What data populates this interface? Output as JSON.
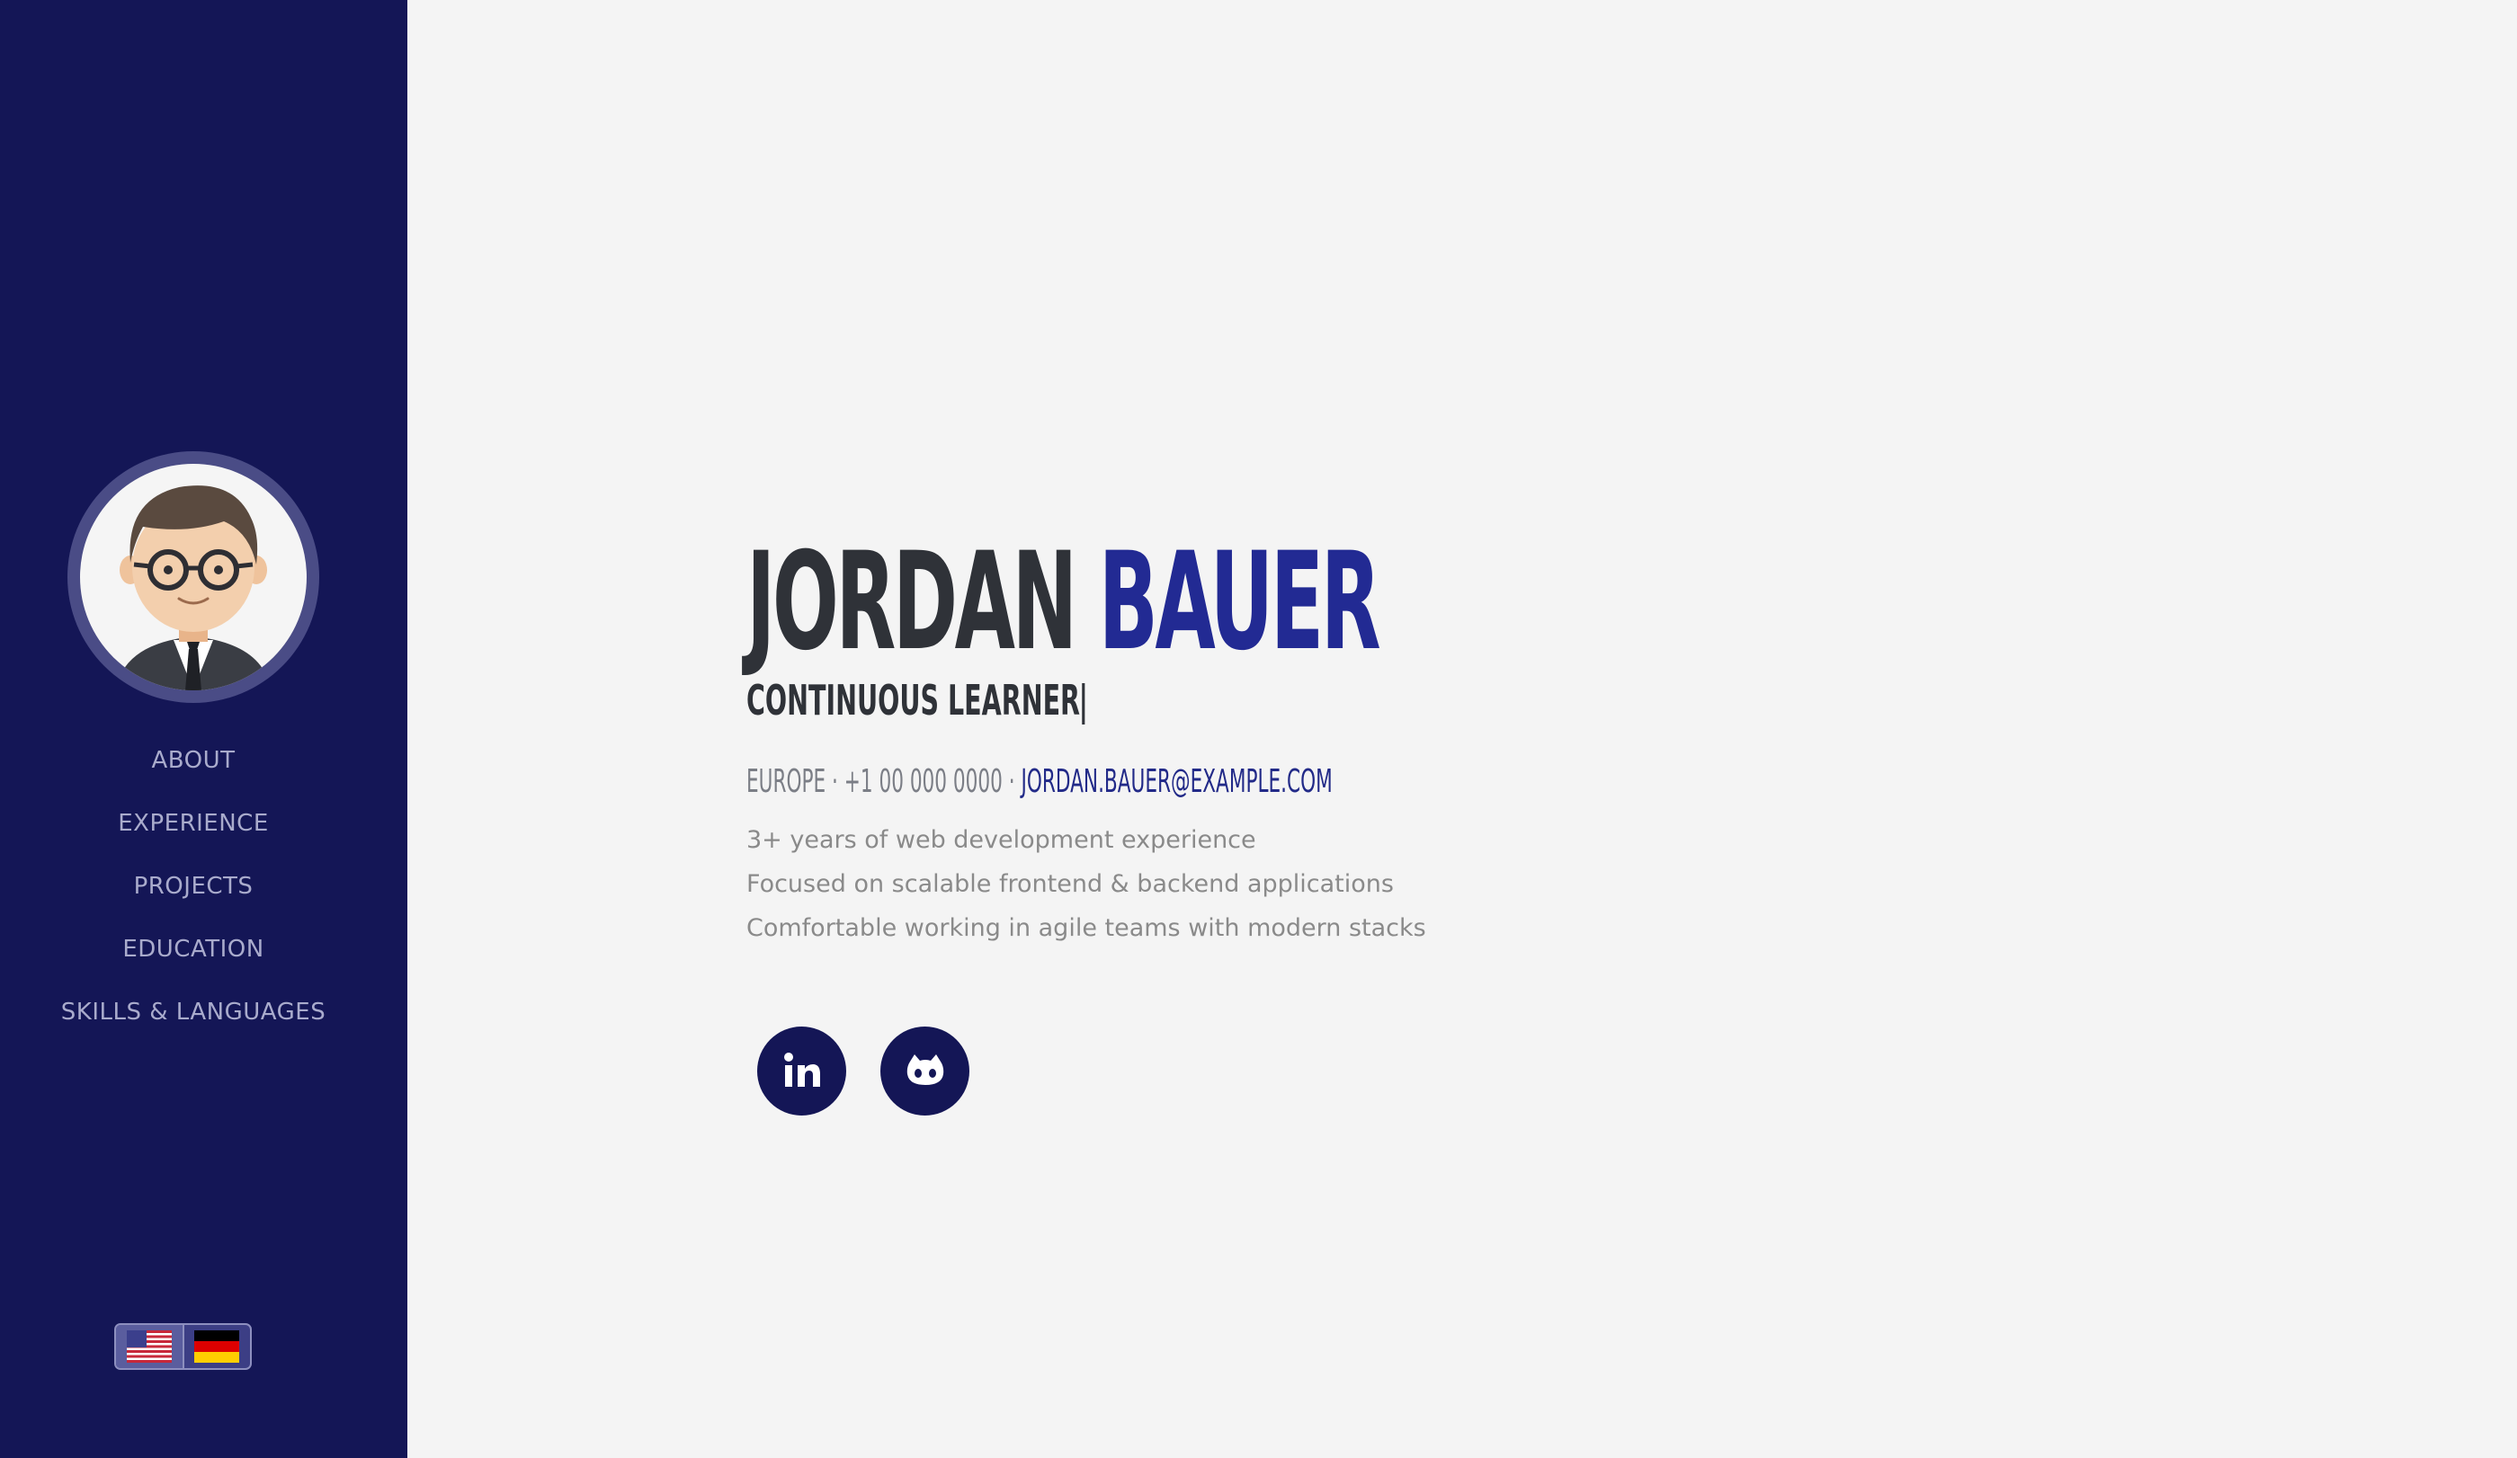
{
  "profile": {
    "first_name": "JORDAN",
    "last_name": "BAUER",
    "tagline": "CONTINUOUS LEARNER",
    "location": "EUROPE",
    "separator": "·",
    "phone": "+1 00 000 0000",
    "email": "JORDAN.BAUER@EXAMPLE.COM",
    "highlights": [
      "3+ years of web development experience",
      "Focused on scalable frontend & backend applications",
      "Comfortable working in agile teams with modern stacks"
    ]
  },
  "sidebar": {
    "nav": [
      {
        "label": "ABOUT"
      },
      {
        "label": "EXPERIENCE"
      },
      {
        "label": "PROJECTS"
      },
      {
        "label": "EDUCATION"
      },
      {
        "label": "SKILLS & LANGUAGES"
      }
    ],
    "languages": [
      {
        "icon": "us-flag-icon",
        "active": true
      },
      {
        "icon": "de-flag-icon",
        "active": false
      }
    ]
  },
  "socials": [
    {
      "icon": "linkedin-icon"
    },
    {
      "icon": "github-icon"
    }
  ],
  "colors": {
    "sidebar_bg": "#141656",
    "accent": "#222a93",
    "text_dark": "#2f3238",
    "page_bg": "#f4f4f4"
  }
}
